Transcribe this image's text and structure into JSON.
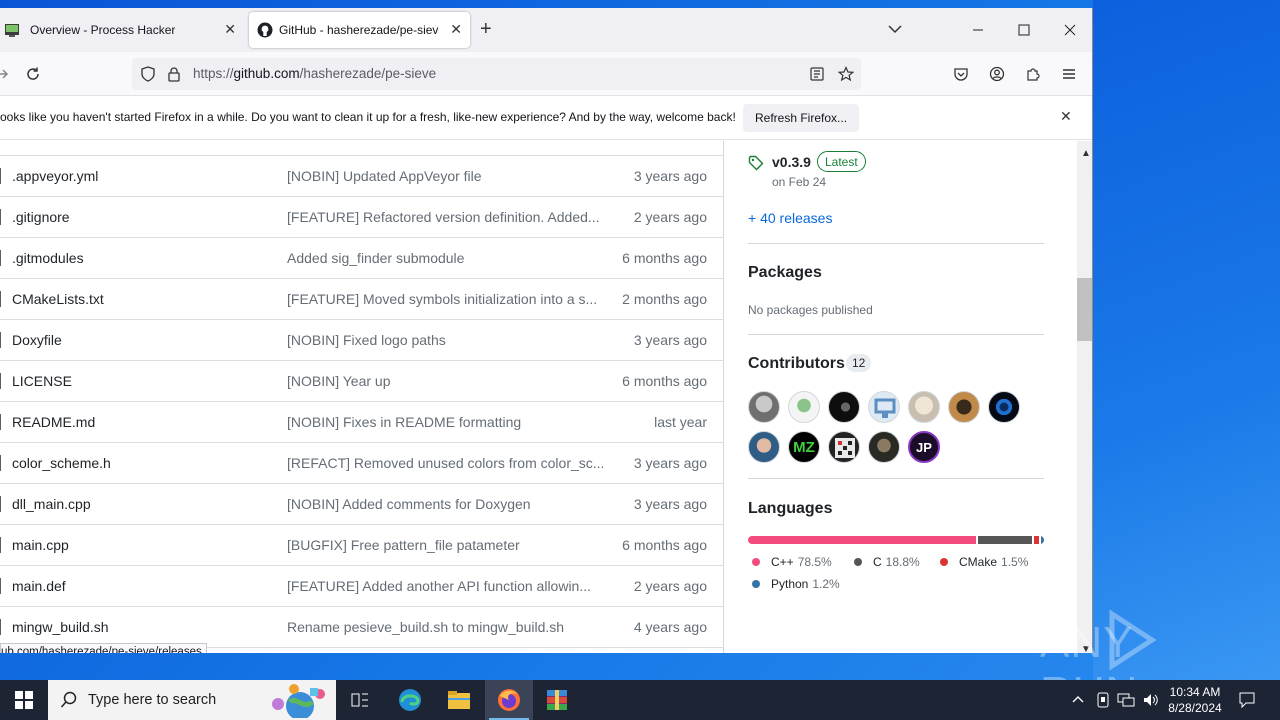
{
  "browser": {
    "tabs": [
      {
        "label": "Overview - Process Hacker",
        "active": false
      },
      {
        "label": "GitHub - hasherezade/pe-sieve",
        "active": true
      }
    ],
    "url": {
      "scheme": "https://",
      "host": "github.com",
      "path": "/hasherezade/pe-sieve"
    },
    "notification": {
      "text": "ooks like you haven't started Firefox in a while. Do you want to clean it up for a fresh, like-new experience? And by the way, welcome back!",
      "button": "Refresh Firefox..."
    },
    "status_url": "ub.com/hasherezade/pe-sieve/releases"
  },
  "files": [
    {
      "name": ".appveyor.yml",
      "message": "[NOBIN] Updated AppVeyor file",
      "date": "3 years ago"
    },
    {
      "name": ".gitignore",
      "message": "[FEATURE] Refactored version definition. Added...",
      "date": "2 years ago"
    },
    {
      "name": ".gitmodules",
      "message": "Added sig_finder submodule",
      "date": "6 months ago"
    },
    {
      "name": "CMakeLists.txt",
      "message": "[FEATURE] Moved symbols initialization into a s...",
      "date": "2 months ago"
    },
    {
      "name": "Doxyfile",
      "message": "[NOBIN] Fixed logo paths",
      "date": "3 years ago"
    },
    {
      "name": "LICENSE",
      "message": "[NOBIN] Year up",
      "date": "6 months ago"
    },
    {
      "name": "README.md",
      "message": "[NOBIN] Fixes in README formatting",
      "date": "last year"
    },
    {
      "name": "color_scheme.h",
      "message": "[REFACT] Removed unused colors from color_sc...",
      "date": "3 years ago"
    },
    {
      "name": "dll_main.cpp",
      "message": "[NOBIN] Added comments for Doxygen",
      "date": "3 years ago"
    },
    {
      "name": "main.cpp",
      "message": "[BUGFIX] Free pattern_file patameter",
      "date": "6 months ago"
    },
    {
      "name": "main.def",
      "message": "[FEATURE] Added another API function allowin...",
      "date": "2 years ago"
    },
    {
      "name": "mingw_build.sh",
      "message": "Rename pesieve_build.sh to mingw_build.sh",
      "date": "4 years ago"
    }
  ],
  "sidebar": {
    "release": {
      "version": "v0.3.9",
      "badge": "Latest",
      "date": "on Feb 24"
    },
    "releases_link": "+ 40 releases",
    "packages": {
      "title": "Packages",
      "note": "No packages published"
    },
    "contributors": {
      "title": "Contributors",
      "count": "12"
    },
    "languages": {
      "title": "Languages",
      "items": [
        {
          "name": "C++",
          "percent": "78.5%",
          "value": 78.5,
          "color": "#f34b7d"
        },
        {
          "name": "C",
          "percent": "18.8%",
          "value": 18.8,
          "color": "#555555"
        },
        {
          "name": "CMake",
          "percent": "1.5%",
          "value": 1.5,
          "color": "#da3434"
        },
        {
          "name": "Python",
          "percent": "1.2%",
          "value": 1.2,
          "color": "#3572a5"
        }
      ]
    }
  },
  "taskbar": {
    "search_placeholder": "Type here to search",
    "time": "10:34 AM",
    "date": "8/28/2024"
  },
  "watermark": "ANY RUN",
  "colors": {
    "accent": "#0969da",
    "latest": "#1a7f37",
    "taskbar": "#1d2433"
  }
}
